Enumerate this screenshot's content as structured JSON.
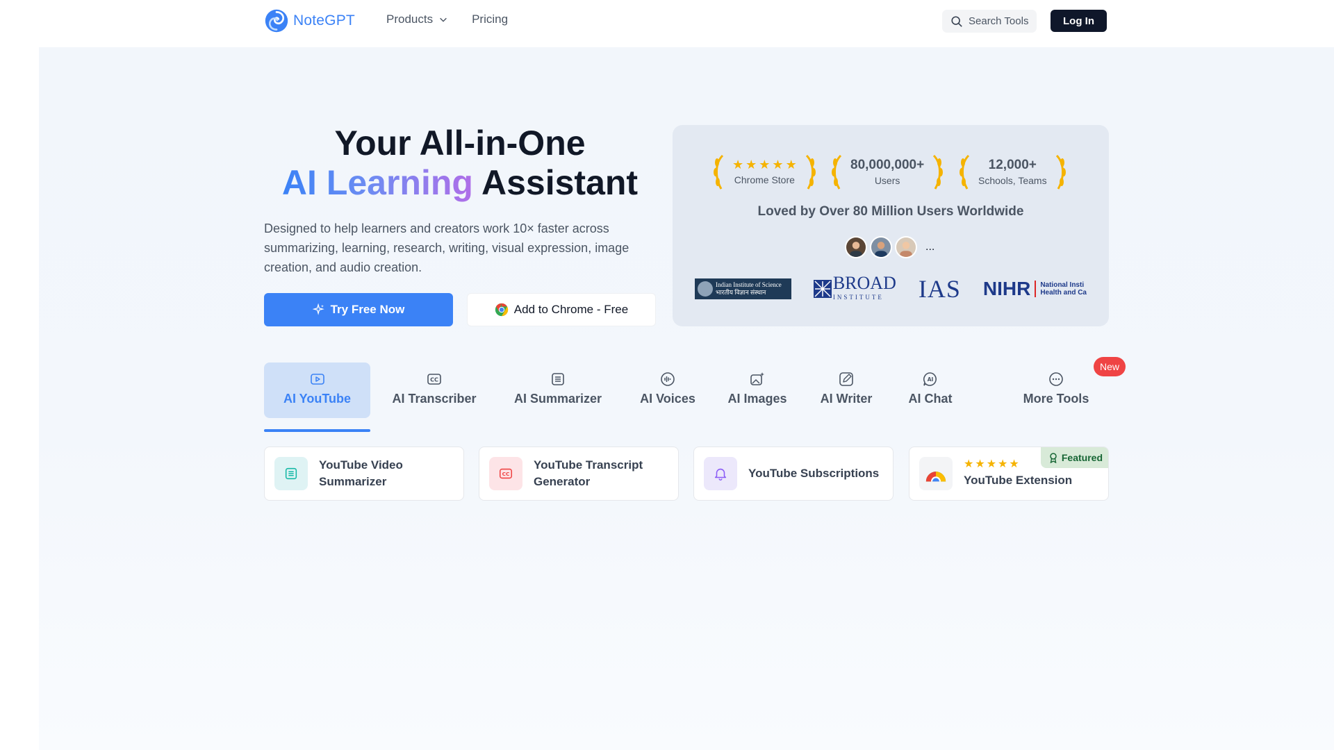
{
  "header": {
    "brand": "NoteGPT",
    "nav": [
      {
        "label": "Products",
        "has_dropdown": true
      },
      {
        "label": "Pricing",
        "has_dropdown": false
      }
    ],
    "search_label": "Search Tools",
    "login_label": "Log In"
  },
  "hero": {
    "title_line1": "Your All-in-One",
    "title_line2_accent": "AI Learning",
    "title_line2_rest": "Assistant",
    "description": "Designed to help learners and creators work 10× faster across summarizing, learning, research, writing, visual expression, image creation, and audio creation.",
    "primary_button": "Try Free Now",
    "secondary_button": "Add to Chrome",
    "secondary_button_suffix": " - Free"
  },
  "stats": {
    "items": [
      {
        "value": "",
        "label": "Chrome Store",
        "stars": 5
      },
      {
        "value": "80,000,000+",
        "label": "Users"
      },
      {
        "value": "12,000+",
        "label": "Schools, Teams"
      }
    ],
    "loved": "Loved by Over 80 Million Users Worldwide",
    "avatars_more": "...",
    "logos": {
      "iisc_line1": "Indian Institute of Science",
      "iisc_line2": "भारतीय विज्ञान संस्थान",
      "broad_line1": "BROAD",
      "broad_line2": "INSTITUTE",
      "ias": "IAS",
      "nihr": "NIHR",
      "nihr_line1": "National Insti",
      "nihr_line2": "Health and Ca"
    }
  },
  "tabs": [
    {
      "label": "AI YouTube",
      "icon": "play-icon",
      "active": true
    },
    {
      "label": "AI Transcriber",
      "icon": "cc-icon",
      "active": false
    },
    {
      "label": "AI Summarizer",
      "icon": "list-icon",
      "active": false
    },
    {
      "label": "AI Voices",
      "icon": "waveform-icon",
      "active": false
    },
    {
      "label": "AI Images",
      "icon": "image-sparkle-icon",
      "active": false
    },
    {
      "label": "AI Writer",
      "icon": "pen-icon",
      "active": false
    },
    {
      "label": "AI Chat",
      "icon": "ai-chat-icon",
      "active": false
    },
    {
      "label": "More Tools",
      "icon": "more-icon",
      "active": false
    }
  ],
  "new_badge": "New",
  "tools": [
    {
      "label_line1": "YouTube Video",
      "label_line2": "Summarizer",
      "icon": "list-icon",
      "icon_bg": "#dff3f4",
      "icon_color": "#14b8a6"
    },
    {
      "label_line1": "YouTube Transcript",
      "label_line2": "Generator",
      "icon": "cc-icon",
      "icon_bg": "#fde4e7",
      "icon_color": "#ef4444"
    },
    {
      "label_line1": "YouTube Subscriptions",
      "label_line2": "",
      "icon": "bell-icon",
      "icon_bg": "#ece8fb",
      "icon_color": "#8b5cf6"
    },
    {
      "label_line1": "YouTube Extension",
      "label_line2": "",
      "icon": "chrome-icon",
      "stars": 5,
      "featured": "Featured"
    }
  ],
  "colors": {
    "accent": "#3b82f6",
    "dark_button": "#0f172a",
    "star": "#f5b301",
    "new_badge": "#ef4444",
    "featured_bg": "#d8ead8"
  }
}
